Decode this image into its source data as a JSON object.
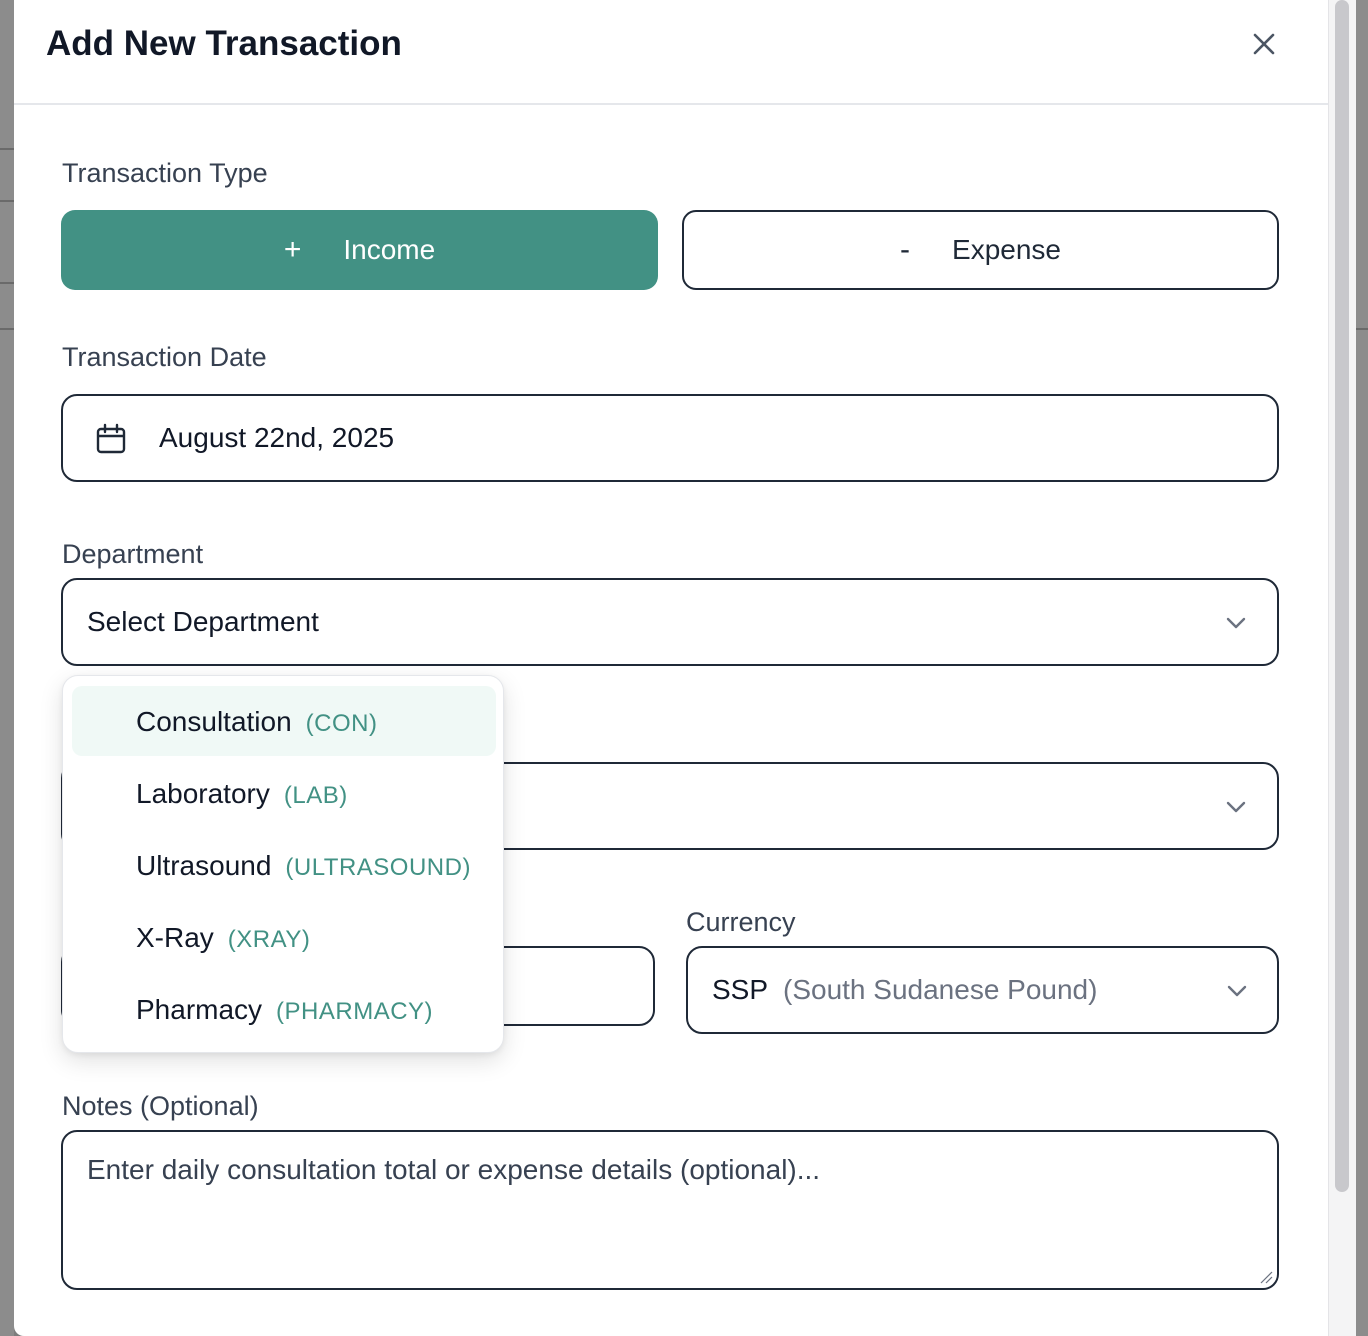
{
  "modal": {
    "title": "Add New Transaction"
  },
  "transaction_type": {
    "label": "Transaction Type",
    "income": {
      "symbol": "+",
      "label": "Income"
    },
    "expense": {
      "symbol": "-",
      "label": "Expense"
    },
    "selected": "Income"
  },
  "transaction_date": {
    "label": "Transaction Date",
    "value": "August 22nd, 2025"
  },
  "department": {
    "label": "Department",
    "placeholder": "Select Department",
    "options": [
      {
        "name": "Consultation",
        "code": "(CON)"
      },
      {
        "name": "Laboratory",
        "code": "(LAB)"
      },
      {
        "name": "Ultrasound",
        "code": "(ULTRASOUND)"
      },
      {
        "name": "X-Ray",
        "code": "(XRAY)"
      },
      {
        "name": "Pharmacy",
        "code": "(PHARMACY)"
      }
    ]
  },
  "currency": {
    "label": "Currency",
    "code": "SSP",
    "name": "(South Sudanese Pound)"
  },
  "notes": {
    "label": "Notes (Optional)",
    "placeholder": "Enter daily consultation total or expense details (optional)..."
  },
  "colors": {
    "accent": "#429184",
    "border": "#1f2937",
    "highlight": "#f0f9f6"
  }
}
